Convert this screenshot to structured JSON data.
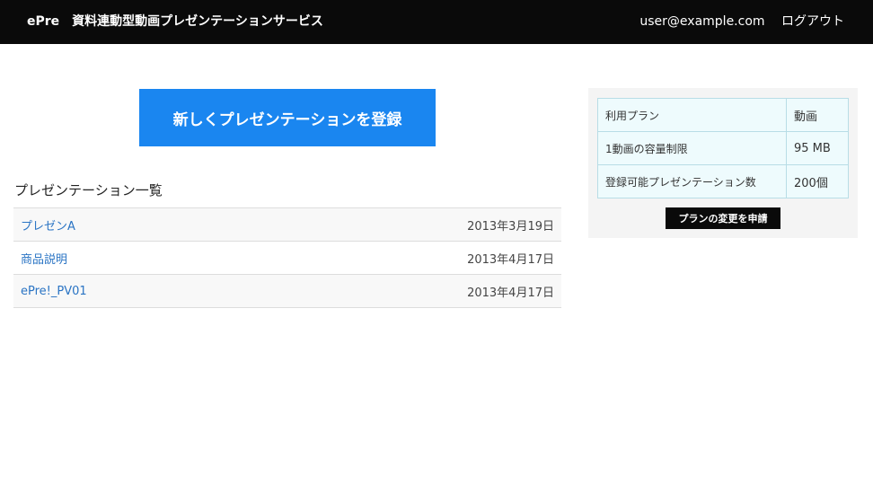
{
  "header": {
    "brand": "ePre",
    "service_title": "資料連動型動画プレゼンテーションサービス",
    "user_email": "user@example.com",
    "logout_label": "ログアウト"
  },
  "main": {
    "register_button_label": "新しくプレゼンテーションを登録",
    "list_heading": "プレゼンテーション一覧",
    "presentations": [
      {
        "title": "プレゼンA",
        "date": "2013年3月19日"
      },
      {
        "title": "商品説明",
        "date": "2013年4月17日"
      },
      {
        "title": "ePre!_PV01",
        "date": "2013年4月17日"
      }
    ]
  },
  "plan": {
    "rows": [
      {
        "label": "利用プラン",
        "value": "動画"
      },
      {
        "label": "1動画の容量制限",
        "value": "95 MB"
      },
      {
        "label": "登録可能プレゼンテーション数",
        "value": "200個"
      }
    ],
    "change_button_label": "プランの変更を申請"
  },
  "colors": {
    "topbar_bg": "#0a0a0a",
    "primary_button": "#1a86f0",
    "link": "#2a74c4",
    "plan_cell_bg": "#eefbfd"
  }
}
